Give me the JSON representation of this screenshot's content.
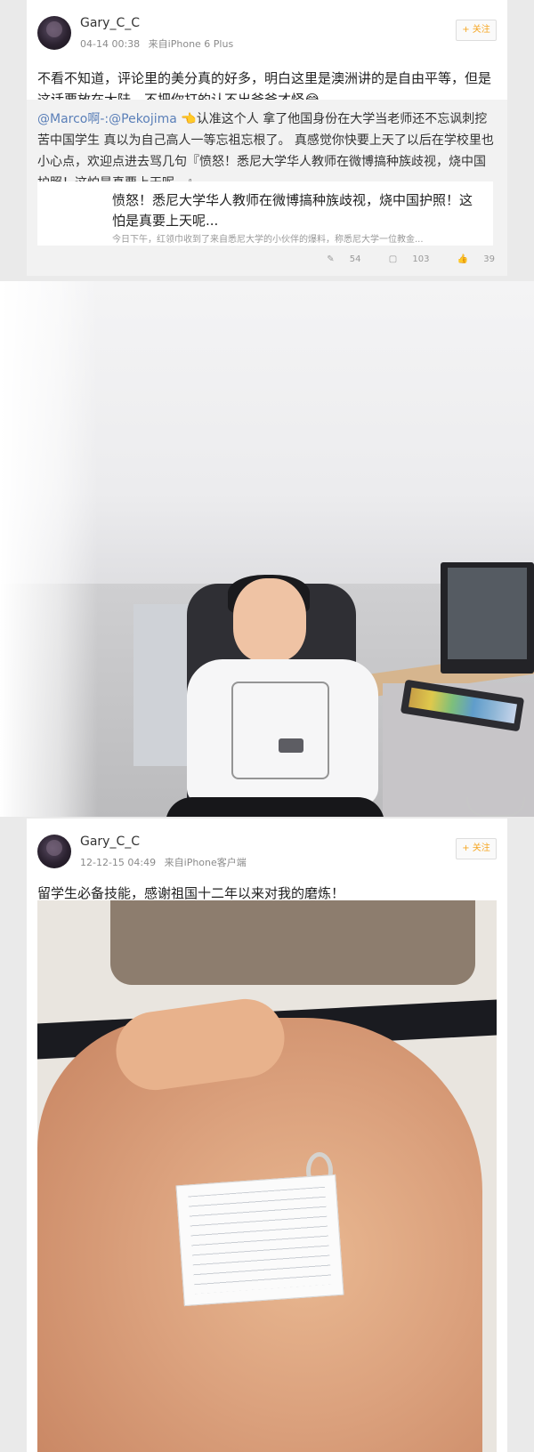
{
  "post1": {
    "username": "Gary_C_C",
    "time": "04-14 00:38",
    "source": "来自iPhone 6 Plus",
    "follow": "+ 关注",
    "text": "不看不知道，评论里的美分真的好多，明白这里是澳洲讲的是自由平等，但是这话要放在大陆，不把你打的认不出爸爸才怪😂",
    "repost": {
      "mention": "@Marco啊-:@Pekojima",
      "text": "👈认准这个人 拿了他国身份在大学当老师还不忘讽刺挖苦中国学生 真以为自己高人一等忘祖忘根了。 真感觉你快要上天了以后在学校里也小心点，欢迎点进去骂几句『愤怒！悉尼大学华人教师在微博搞种族歧视，烧中国护照！这怕是真要上天呢...』",
      "card_title": "愤怒！悉尼大学华人教师在微博搞种族歧视，烧中国护照！这怕是真要上天呢...",
      "card_desc": "今日下午，红领巾收到了来自悉尼大学的小伙伴的爆料，称悉尼大学一位教金..."
    },
    "stats": {
      "forward": "54",
      "comment": "103",
      "like": "39"
    }
  },
  "post2": {
    "username": "Gary_C_C",
    "time": "12-12-15 04:49",
    "source": "来自iPhone客户端",
    "follow": "+ 关注",
    "text": "留学生必备技能，感谢祖国十二年以来对我的磨炼！"
  },
  "icons": {
    "forward": "edit-icon",
    "comment": "comment-icon",
    "like": "thumb-up-icon"
  }
}
